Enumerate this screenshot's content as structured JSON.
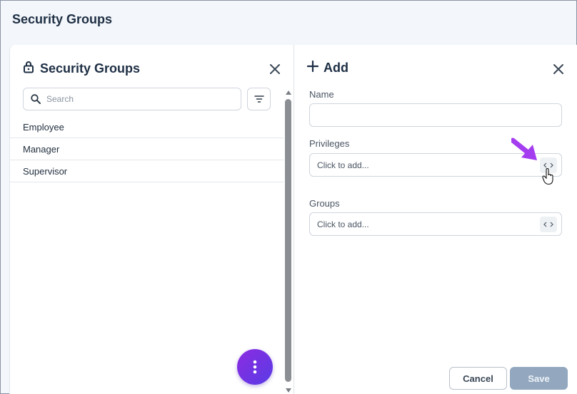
{
  "page": {
    "title": "Security Groups"
  },
  "left_panel": {
    "title": "Security Groups",
    "search": {
      "placeholder": "Search",
      "value": ""
    },
    "items": [
      {
        "label": "Employee"
      },
      {
        "label": "Manager"
      },
      {
        "label": "Supervisor"
      }
    ]
  },
  "right_panel": {
    "title": "Add",
    "fields": {
      "name": {
        "label": "Name",
        "value": ""
      },
      "privileges": {
        "label": "Privileges",
        "placeholder": "Click to add..."
      },
      "groups": {
        "label": "Groups",
        "placeholder": "Click to add..."
      }
    },
    "buttons": {
      "cancel": "Cancel",
      "save": "Save"
    }
  },
  "colors": {
    "accent_gradient_start": "#8b2ce0",
    "accent_gradient_end": "#5a3be6",
    "save_disabled": "#93a8bf",
    "highlight_arrow": "#a43cf0"
  },
  "icons": {
    "lock": "lock-icon",
    "close": "close-icon",
    "search": "search-icon",
    "filter": "filter-icon",
    "plus": "plus-icon",
    "more": "more-vertical-icon",
    "picker": "picker-icon"
  }
}
